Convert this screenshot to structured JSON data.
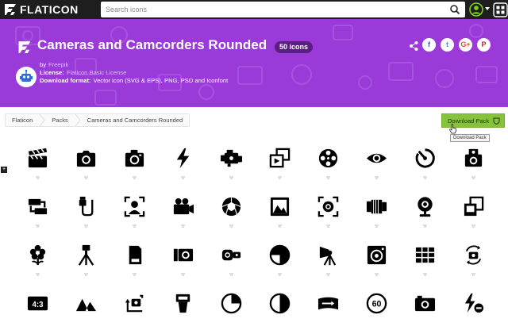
{
  "topbar": {
    "logo_text": "FLATICON",
    "search_placeholder": "Search icons",
    "icons": [
      "flaticon-logo-icon",
      "search-icon",
      "user-icon",
      "caret-down-icon",
      "grid-icon"
    ]
  },
  "hero": {
    "title": "Cameras and Camcorders Rounded",
    "count_badge": "50 icons",
    "by_label": "by",
    "author": "Freepik",
    "license_label": "License:",
    "license_value": "Flaticon Basic License",
    "format_label": "Download format:",
    "format_value": "Vector icon (SVG & EPS), PNG, PSD and Iconfont",
    "share_buttons": [
      "f",
      "t",
      "G+",
      "P"
    ],
    "colors": {
      "background": "#9a3ad9",
      "badge": "#5a1f80"
    }
  },
  "breadcrumb": [
    "Flaticon",
    "Packs",
    "Cameras and Camcorders Rounded"
  ],
  "download_button": {
    "label": "Download Pack",
    "tooltip": "Download Pack",
    "color": "#86c23c"
  },
  "icon_grid": [
    [
      "clapperboard-icon",
      "camera-icon",
      "camera-2-icon",
      "flash-icon",
      "camcorder-icon",
      "slideshow-icon",
      "film-reel-icon",
      "eye-icon",
      "timer-icon",
      "camera-3-icon"
    ],
    [
      "swap-camera-icon",
      "usb-cable-icon",
      "portrait-mode-icon",
      "video-camera-icon",
      "aperture-icon",
      "landscape-icon",
      "focus-icon",
      "lens-icon",
      "webcam-icon",
      "photos-icon"
    ],
    [
      "macro-flower-icon",
      "tripod-icon",
      "memory-card-icon",
      "compact-camera-icon",
      "action-camera-icon",
      "exposure-icon",
      "studio-light-icon",
      "camera-lens-icon",
      "grid-icon",
      "rotate-camera-icon"
    ],
    [
      "aspect-ratio-icon",
      "mountains-icon",
      "rotate-icon",
      "external-flash-icon",
      "pie-timer-icon",
      "contrast-icon",
      "panorama-icon",
      "speed-60-icon",
      "camera-body-icon",
      "flash-off-icon"
    ]
  ],
  "aspect_ratio_text": "4:3",
  "speed_text": "60",
  "expand_label": "+"
}
